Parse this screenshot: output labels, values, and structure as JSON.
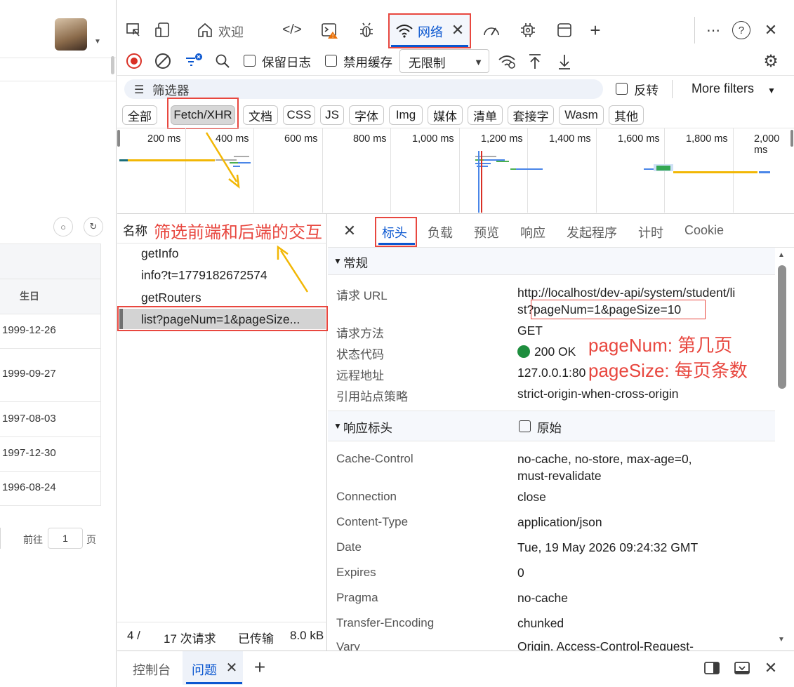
{
  "left_panel": {
    "column_header": "生日",
    "dates": [
      "1999-12-26",
      "1999-09-27",
      "1997-08-03",
      "1997-12-30",
      "1996-08-24"
    ],
    "pager_prefix": "前往",
    "pager_value": "1",
    "pager_suffix": "页"
  },
  "tabs": {
    "welcome": "欢迎",
    "network": "网络"
  },
  "toolbar": {
    "preserve_log": "保留日志",
    "disable_cache": "禁用缓存",
    "throttle": "无限制"
  },
  "filter": {
    "placeholder": "筛选器",
    "invert": "反转",
    "more_filters": "More filters"
  },
  "type_filters": [
    "全部",
    "Fetch/XHR",
    "文档",
    "CSS",
    "JS",
    "字体",
    "Img",
    "媒体",
    "清单",
    "套接字",
    "Wasm",
    "其他"
  ],
  "timeline_ticks": [
    "200 ms",
    "400 ms",
    "600 ms",
    "800 ms",
    "1,000 ms",
    "1,200 ms",
    "1,400 ms",
    "1,600 ms",
    "1,800 ms",
    "2,000 ms"
  ],
  "request_list": {
    "header": "名称",
    "items": [
      "getInfo",
      "info?t=1779182672574",
      "getRouters",
      "list?pageNum=1&pageSize..."
    ],
    "status_count": "4 /",
    "status_requests": "17 次请求",
    "status_transferred": "已传输",
    "status_size": "8.0 kB"
  },
  "detail_tabs": [
    "标头",
    "负载",
    "预览",
    "响应",
    "发起程序",
    "计时",
    "Cookie"
  ],
  "general": {
    "title": "常规",
    "url_label": "请求 URL",
    "url_line1": "http://localhost/dev-api/system/student/li",
    "url_line2a": "st?",
    "url_line2b": "pageNum=1&pageSize=10",
    "method_label": "请求方法",
    "method": "GET",
    "status_label": "状态代码",
    "status": "200 OK",
    "remote_label": "远程地址",
    "remote": "127.0.0.1:80",
    "referrer_label": "引用站点策略",
    "referrer": "strict-origin-when-cross-origin"
  },
  "response_headers": {
    "title": "响应标头",
    "raw": "原始",
    "rows": [
      {
        "k": "Cache-Control",
        "v": "no-cache, no-store, max-age=0,",
        "v2": "must-revalidate"
      },
      {
        "k": "Connection",
        "v": "close"
      },
      {
        "k": "Content-Type",
        "v": "application/json"
      },
      {
        "k": "Date",
        "v": "Tue, 19 May 2026 09:24:32 GMT"
      },
      {
        "k": "Expires",
        "v": "0"
      },
      {
        "k": "Pragma",
        "v": "no-cache"
      },
      {
        "k": "Transfer-Encoding",
        "v": "chunked"
      },
      {
        "k": "Vary",
        "v": "Origin, Access-Control-Request-"
      }
    ]
  },
  "annotations": {
    "filter_note": "筛选前端和后端的交互",
    "page_num": "pageNum: 第几页",
    "page_size": "pageSize: 每页条数"
  },
  "drawer": {
    "console": "控制台",
    "issues": "问题"
  },
  "colors": {
    "accent": "#0b57d0",
    "annotation": "#e8473f",
    "arrow": "#f2b705",
    "status_ok": "#1e8e3e"
  }
}
